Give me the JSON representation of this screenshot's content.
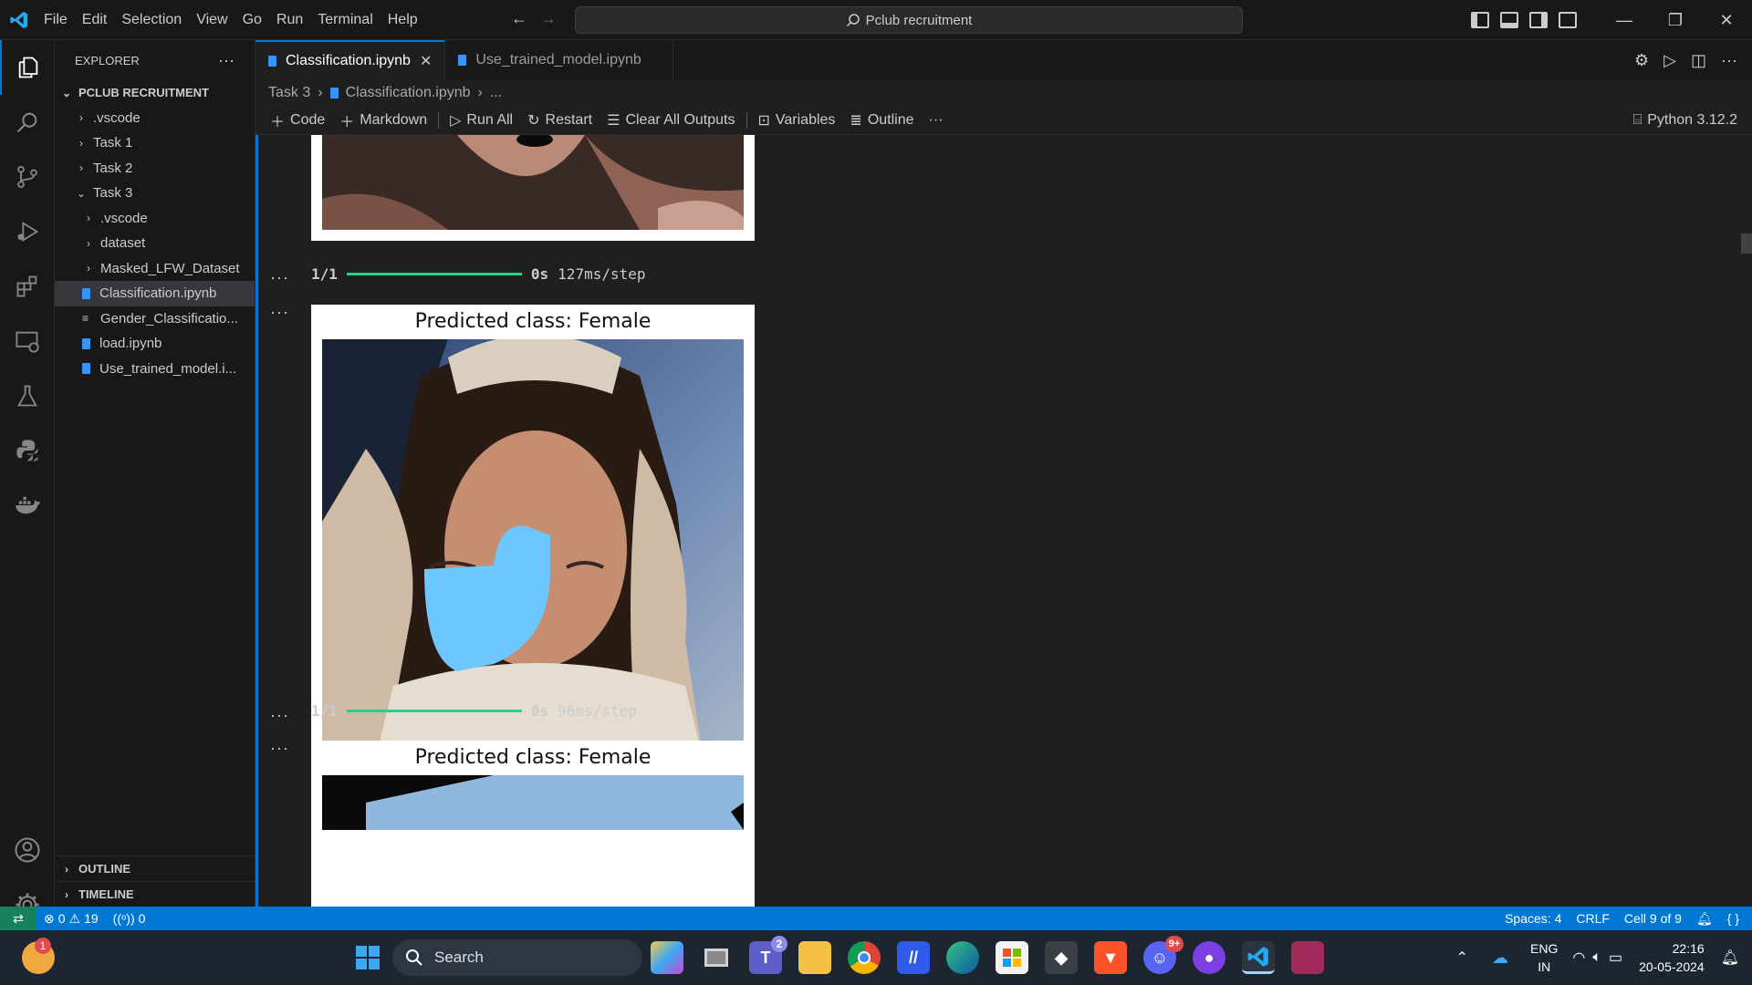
{
  "menu": [
    "File",
    "Edit",
    "Selection",
    "View",
    "Go",
    "Run",
    "Terminal",
    "Help"
  ],
  "command_center": "Pclub recruitment",
  "explorer": {
    "title": "EXPLORER",
    "root": "PCLUB RECRUITMENT",
    "items": [
      {
        "label": ".vscode",
        "indent": 1,
        "type": "folder-closed"
      },
      {
        "label": "Task 1",
        "indent": 1,
        "type": "folder-closed"
      },
      {
        "label": "Task 2",
        "indent": 1,
        "type": "folder-closed"
      },
      {
        "label": "Task 3",
        "indent": 1,
        "type": "folder-open"
      },
      {
        "label": ".vscode",
        "indent": 2,
        "type": "folder-closed"
      },
      {
        "label": "dataset",
        "indent": 2,
        "type": "folder-closed"
      },
      {
        "label": "Masked_LFW_Dataset",
        "indent": 2,
        "type": "folder-closed"
      },
      {
        "label": "Classification.ipynb",
        "indent": 2,
        "type": "notebook",
        "selected": true
      },
      {
        "label": "Gender_Classificatio...",
        "indent": 2,
        "type": "text"
      },
      {
        "label": "load.ipynb",
        "indent": 2,
        "type": "notebook"
      },
      {
        "label": "Use_trained_model.i...",
        "indent": 2,
        "type": "notebook"
      }
    ],
    "outline": "OUTLINE",
    "timeline": "TIMELINE"
  },
  "tabs": [
    {
      "label": "Classification.ipynb",
      "active": true
    },
    {
      "label": "Use_trained_model.ipynb",
      "active": false
    }
  ],
  "breadcrumb": [
    "Task 3",
    "Classification.ipynb",
    "..."
  ],
  "toolbar": {
    "code": "Code",
    "markdown": "Markdown",
    "run_all": "Run All",
    "restart": "Restart",
    "clear": "Clear All Outputs",
    "variables": "Variables",
    "outline": "Outline",
    "kernel": "Python 3.12.2"
  },
  "outputs": {
    "progress1": {
      "count": "1/1",
      "time": "0s",
      "rate": "127ms/step"
    },
    "image1_title": "Predicted class: Female",
    "progress2": {
      "count": "1/1",
      "time": "0s",
      "rate": "96ms/step"
    },
    "image2_title": "Predicted class: Female"
  },
  "status": {
    "errors": "0",
    "warnings": "19",
    "ports": "0",
    "spaces": "Spaces: 4",
    "eol": "CRLF",
    "cell": "Cell 9 of 9"
  },
  "taskbar": {
    "search": "Search",
    "weather_badge": "1",
    "teams_badge": "2",
    "discord_badge": "9+",
    "lang1": "ENG",
    "lang2": "IN",
    "time": "22:16",
    "date": "20-05-2024"
  },
  "colors": {
    "accent": "#0078d4",
    "progress": "#23d18b",
    "mask": "#6ec6ff"
  }
}
